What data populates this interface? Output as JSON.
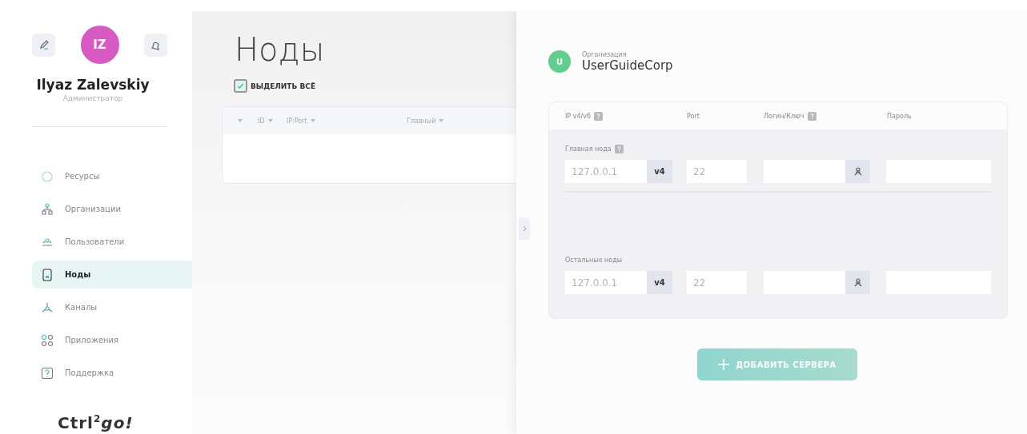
{
  "sidebar": {
    "user": {
      "initials": "IZ",
      "name": "Ilyaz Zalevskiy",
      "role": "Администратор"
    },
    "menu": [
      {
        "label": "Ресурсы",
        "kind": "circle",
        "selected": false
      },
      {
        "label": "Организации",
        "kind": "org",
        "selected": false
      },
      {
        "label": "Пользователи",
        "kind": "users",
        "selected": false
      },
      {
        "label": "Ноды",
        "kind": "node",
        "selected": true
      },
      {
        "label": "Каналы",
        "kind": "channel",
        "selected": false
      },
      {
        "label": "Приложения",
        "kind": "apps",
        "selected": false
      },
      {
        "label": "Поддержка",
        "kind": "help",
        "selected": false
      }
    ],
    "logo": "Ctrl$^{2}$*go!*"
  },
  "main": {
    "title": "Ноды",
    "select_all": {
      "label": "ВЫДЕЛИТЬ ВСЁ",
      "checked": true
    },
    "columns": [
      {
        "label": "ID"
      },
      {
        "label": "IP:Port"
      },
      {
        "label": "Главный"
      }
    ]
  },
  "panel": {
    "org": {
      "initial": "U",
      "caption": "Организация",
      "name": "UserGuideCorp"
    },
    "headers": [
      {
        "label": "IP v4/v6",
        "help": true
      },
      {
        "label": "Port",
        "help": false
      },
      {
        "label": "Логин/Ключ",
        "help": true
      },
      {
        "label": "Пароль",
        "help": false
      }
    ],
    "groups": [
      {
        "label": "Главная нода",
        "help": true,
        "rows": [
          {
            "ip": {
              "placeholder": "127.0.0.1"
            },
            "ip_version": "v4",
            "port": {
              "placeholder": "22"
            }
          }
        ]
      },
      {
        "label": "Остальные ноды",
        "help": false,
        "rows": [
          {
            "ip": {
              "placeholder": "127.0.0.1"
            },
            "ip_version": "v4",
            "port": {
              "placeholder": "22"
            }
          }
        ]
      }
    ],
    "add_button": "ДОБАВИТЬ СЕРВЕРА"
  }
}
